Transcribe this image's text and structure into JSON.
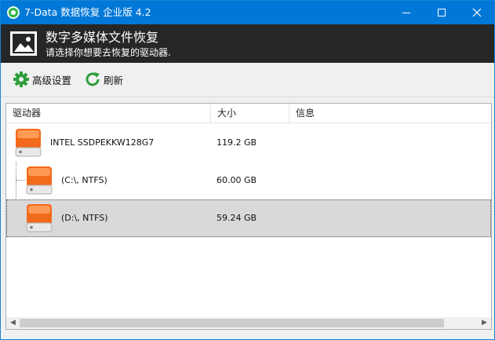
{
  "window": {
    "title": "7-Data 数据恢复 企业版 4.2",
    "controls": {
      "minimize": "minimize",
      "maximize": "maximize",
      "close": "close"
    }
  },
  "banner": {
    "title": "数字多媒体文件恢复",
    "subtitle": "请选择你想要去恢复的驱动器."
  },
  "toolbar": {
    "settings_label": "高级设置",
    "refresh_label": "刷新"
  },
  "list": {
    "columns": {
      "drive": "驱动器",
      "size": "大小",
      "info": "信息"
    },
    "rows": [
      {
        "label": "INTEL SSDPEKKW128G7",
        "size": "119.2 GB",
        "info": "",
        "level": 0,
        "selected": false
      },
      {
        "label": "(C:\\, NTFS)",
        "size": "60.00 GB",
        "info": "",
        "level": 1,
        "selected": false
      },
      {
        "label": "(D:\\, NTFS)",
        "size": "59.24 GB",
        "info": "",
        "level": 1,
        "selected": true
      }
    ]
  },
  "scrollbar": {
    "left_arrow": "◀",
    "right_arrow": "▶"
  },
  "colors": {
    "titlebar": "#0078d7",
    "banner": "#262626",
    "drive_orange": "#f26a1b",
    "selected_row": "#d9d9d9",
    "settings_icon": "#2e9e3a",
    "refresh_icon": "#2e9e3a"
  },
  "icons": {
    "app": "7-data-icon",
    "banner": "image-icon",
    "settings": "gear-icon",
    "refresh": "refresh-icon",
    "drive": "hard-drive-icon"
  }
}
